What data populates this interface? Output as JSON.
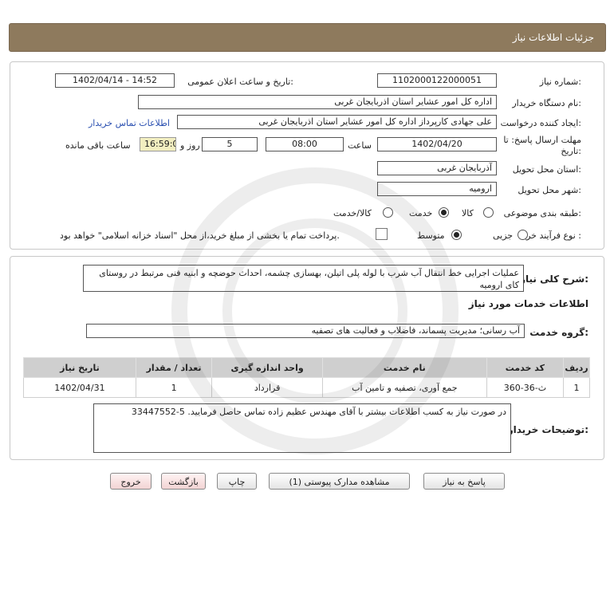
{
  "header": {
    "title": "جزئیات اطلاعات نیاز"
  },
  "form": {
    "need_number_label": "شماره نیاز:",
    "need_number": "1102000122000051",
    "announce_label": "تاریخ و ساعت اعلان عمومی:",
    "announce_value": "1402/04/14 - 14:52",
    "buyer_label": "نام دستگاه خریدار:",
    "buyer_value": "اداره کل امور عشایر استان اذربایجان غربی",
    "requester_label": "ایجاد کننده درخواست:",
    "requester_value": "علی جهادی کارپرداز اداره کل امور عشایر استان اذربایجان غربی",
    "contact_link": "اطلاعات تماس خریدار",
    "deadline_label_1": "مهلت ارسال پاسخ: تا",
    "deadline_label_2": "تاریخ:",
    "deadline_date": "1402/04/20",
    "time_label": "ساعت",
    "deadline_time": "08:00",
    "days_value": "5",
    "days_label": "روز و",
    "remaining_time": "16:59:03",
    "remaining_label": "ساعت باقی مانده",
    "province_label": "استان محل تحویل:",
    "province_value": "آذربایجان غربی",
    "city_label": "شهر محل تحویل:",
    "city_value": "ارومیه",
    "category_label": "طبقه بندی موضوعی:",
    "category_options": [
      "کالا",
      "خدمت",
      "کالا/خدمت"
    ],
    "category_selected": "خدمت",
    "process_label": "نوع فرآیند خرید :",
    "process_options": [
      "جزیی",
      "متوسط"
    ],
    "process_selected": "متوسط",
    "payment_text": "پرداخت تمام یا بخشی از مبلغ خرید،از محل \"اسناد خزانه اسلامی\" خواهد بود."
  },
  "details": {
    "summary_label": "شرح کلی نیاز:",
    "summary_text": "عملیات اجرایی خط انتقال آب شرب با لوله پلی اتیلن، بهسازی چشمه، احداث حوضچه و ابنیه فنی مرتبط در روستای کای ارومیه",
    "services_heading": "اطلاعات خدمات مورد نیاز",
    "service_group_label": "گروه خدمت:",
    "service_group_value": "آب رسانی؛ مدیریت پسماند، فاضلاب و فعالیت های تصفیه",
    "table_headers": [
      "ردیف",
      "کد خدمت",
      "نام خدمت",
      "واحد اندازه گیری",
      "تعداد / مقدار",
      "تاریخ نیاز"
    ],
    "table_rows": [
      [
        "1",
        "ث-36-360",
        "جمع آوری، تصفیه و تامین آب",
        "قرارداد",
        "1",
        "1402/04/31"
      ]
    ],
    "buyer_notes_label": "توضیحات خریدار:",
    "buyer_notes_text": "در صورت نیاز به کسب اطلاعات بیشتر با آقای مهندس عظیم زاده تماس حاصل فرمایید. 5-33447552"
  },
  "buttons": {
    "reply": "پاسخ به نیاز",
    "attachments": "مشاهده مدارک پیوستی (1)",
    "print": "چاپ",
    "back": "بازگشت",
    "exit": "خروج"
  }
}
